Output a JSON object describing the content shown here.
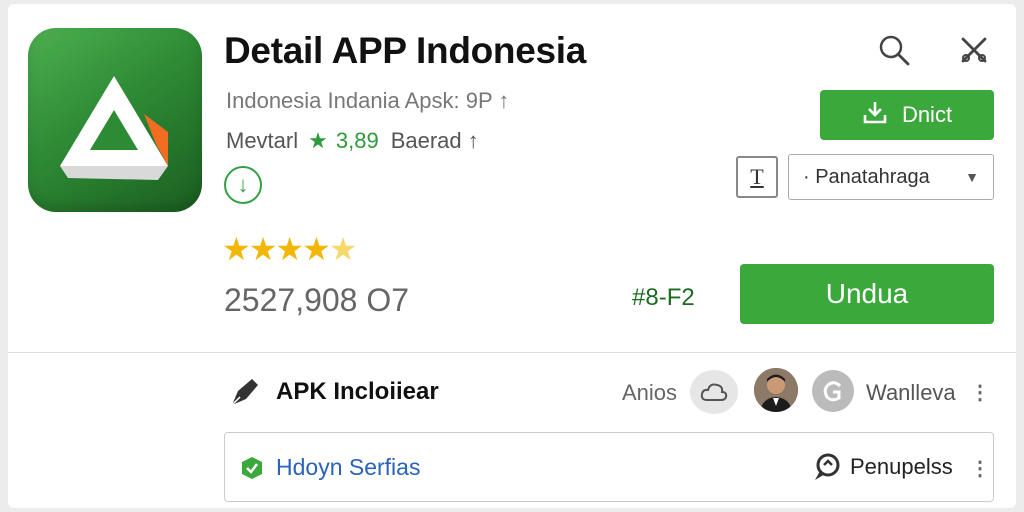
{
  "app": {
    "title": "Detail APP Indonesia",
    "subtitle": "Indonesia Indania Apsk: 9P ↑",
    "developer": "Mevtarl",
    "rating": "3,89",
    "rating_suffix": "Baerad ↑",
    "stars": "★★★★",
    "stars_half": "★",
    "star_rating": 4.5,
    "download_count": "2527,908 O7",
    "code": "#8-F2"
  },
  "header": {
    "search_icon": "search-icon",
    "close_icon": "close-icon"
  },
  "actions": {
    "small_button_label": "Dnict",
    "text_button_label": "T",
    "dropdown_value": "· Panatahrаga",
    "install_button_label": "Undua"
  },
  "bar": {
    "label": "APK Incloiiear",
    "right_label": "Anios",
    "user_label": "Wanlleva",
    "kebab": "⋮"
  },
  "row": {
    "link_label": "Hdoyn Serfias",
    "action_label": "Penupelss",
    "kebab": "⋮"
  },
  "colors": {
    "accent_green": "#3aa83a",
    "rating_green": "#2e9b3a",
    "link_blue": "#2a63b7",
    "star_gold": "#f2b705"
  }
}
